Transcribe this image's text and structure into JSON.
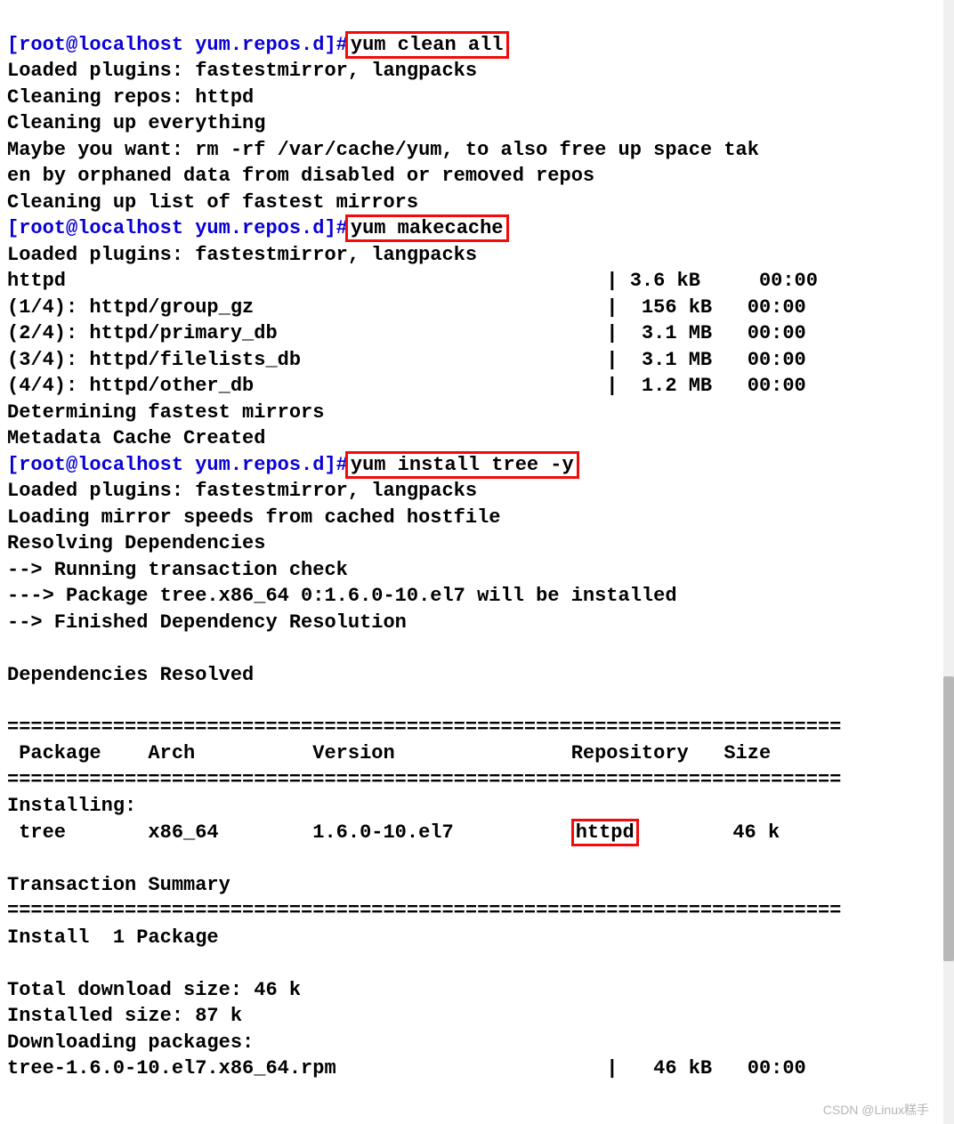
{
  "prompt": "[root@localhost yum.repos.d]",
  "hash": "#",
  "cmd1": "yum clean all",
  "clean": {
    "l1": "Loaded plugins: fastestmirror, langpacks",
    "l2": "Cleaning repos: httpd",
    "l3": "Cleaning up everything",
    "l4": "Maybe you want: rm -rf /var/cache/yum, to also free up space tak",
    "l5": "en by orphaned data from disabled or removed repos",
    "l6": "Cleaning up list of fastest mirrors"
  },
  "cmd2": "yum makecache",
  "make": {
    "l1": "Loaded plugins: fastestmirror, langpacks",
    "r0": "httpd                                              | 3.6 kB     00:00",
    "r1": "(1/4): httpd/group_gz                              |  156 kB   00:00",
    "r2": "(2/4): httpd/primary_db                            |  3.1 MB   00:00",
    "r3": "(3/4): httpd/filelists_db                          |  3.1 MB   00:00",
    "r4": "(4/4): httpd/other_db                              |  1.2 MB   00:00",
    "l2": "Determining fastest mirrors",
    "l3": "Metadata Cache Created"
  },
  "cmd3": "yum install tree -y",
  "install": {
    "l1": "Loaded plugins: fastestmirror, langpacks",
    "l2": "Loading mirror speeds from cached hostfile",
    "l3": "Resolving Dependencies",
    "l4": "--> Running transaction check",
    "l5": "---> Package tree.x86_64 0:1.6.0-10.el7 will be installed",
    "l6": "--> Finished Dependency Resolution",
    "blank1": "",
    "l7": "Dependencies Resolved",
    "blank2": "",
    "sep": "=======================================================================",
    "hdr": " Package    Arch          Version               Repository   Size",
    "sec": "Installing:",
    "row_pre": " tree       x86_64        1.6.0-10.el7          ",
    "row_repo": "httpd",
    "row_post": "        46 k",
    "blank3": "",
    "ts": "Transaction Summary",
    "inst": "Install  1 Package",
    "blank4": "",
    "tdl": "Total download size: 46 k",
    "isz": "Installed size: 87 k",
    "dpk": "Downloading packages:",
    "rpm": "tree-1.6.0-10.el7.x86_64.rpm                       |   46 kB   00:00"
  },
  "watermark": "CSDN @Linux糕手"
}
